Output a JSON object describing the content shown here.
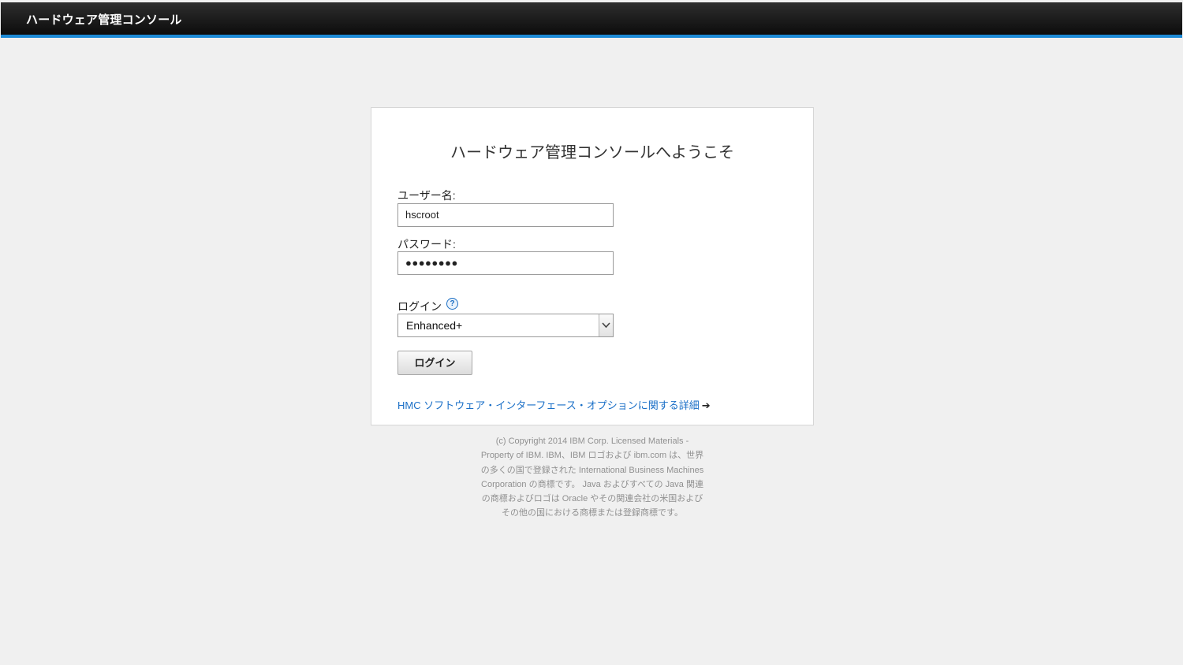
{
  "header": {
    "app_title": "ハードウェア管理コンソール"
  },
  "login_card": {
    "welcome": "ハードウェア管理コンソールへようこそ",
    "username": {
      "label": "ユーザー名:",
      "value": "hscroot"
    },
    "password": {
      "label": "パスワード:",
      "masked_value": "●●●●●●●●"
    },
    "login_type": {
      "label": "ログイン",
      "help_glyph": "?",
      "selected": "Enhanced+"
    },
    "login_button": "ログイン",
    "details_link": "HMC ソフトウェア・インターフェース・オプションに関する詳細",
    "details_link_arrow": "➔"
  },
  "footer": {
    "copyright": "(c) Copyright 2014 IBM Corp. Licensed Materials - Property of IBM. IBM、IBM ロゴおよび ibm.com は、世界の多くの国で登録された International Business Machines Corporation の商標です。 Java およびすべての Java 関連の商標およびロゴは Oracle やその関連会社の米国およびその他の国における商標または登録商標です。"
  },
  "colors": {
    "accent": "#1c8ad6",
    "link": "#1a6fc7",
    "header_bg": "#1a1a1a",
    "page_bg": "#f0f0f0"
  },
  "icons": {
    "help": "help-question-icon",
    "select_arrow": "chevron-down-icon",
    "link_arrow": "arrow-right-icon"
  }
}
